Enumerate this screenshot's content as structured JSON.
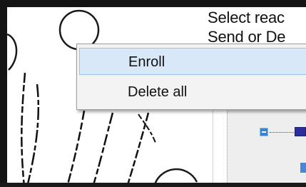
{
  "instructions": {
    "line1": "Select reac",
    "line2": "Send or De"
  },
  "context_menu": {
    "items": [
      {
        "label": "Enroll",
        "state": "hovered"
      },
      {
        "label": "Delete all",
        "state": "normal"
      }
    ]
  },
  "colors": {
    "menu_background": "#f3f3f3",
    "menu_hover": "#d8e8f8",
    "menu_hover_border": "#9cc3ea",
    "tree_node": "#3a84cf",
    "device_icon": "#2b2f9e"
  },
  "icons": {
    "tree_node": "collapse-node-icon",
    "device": "device-icon"
  }
}
